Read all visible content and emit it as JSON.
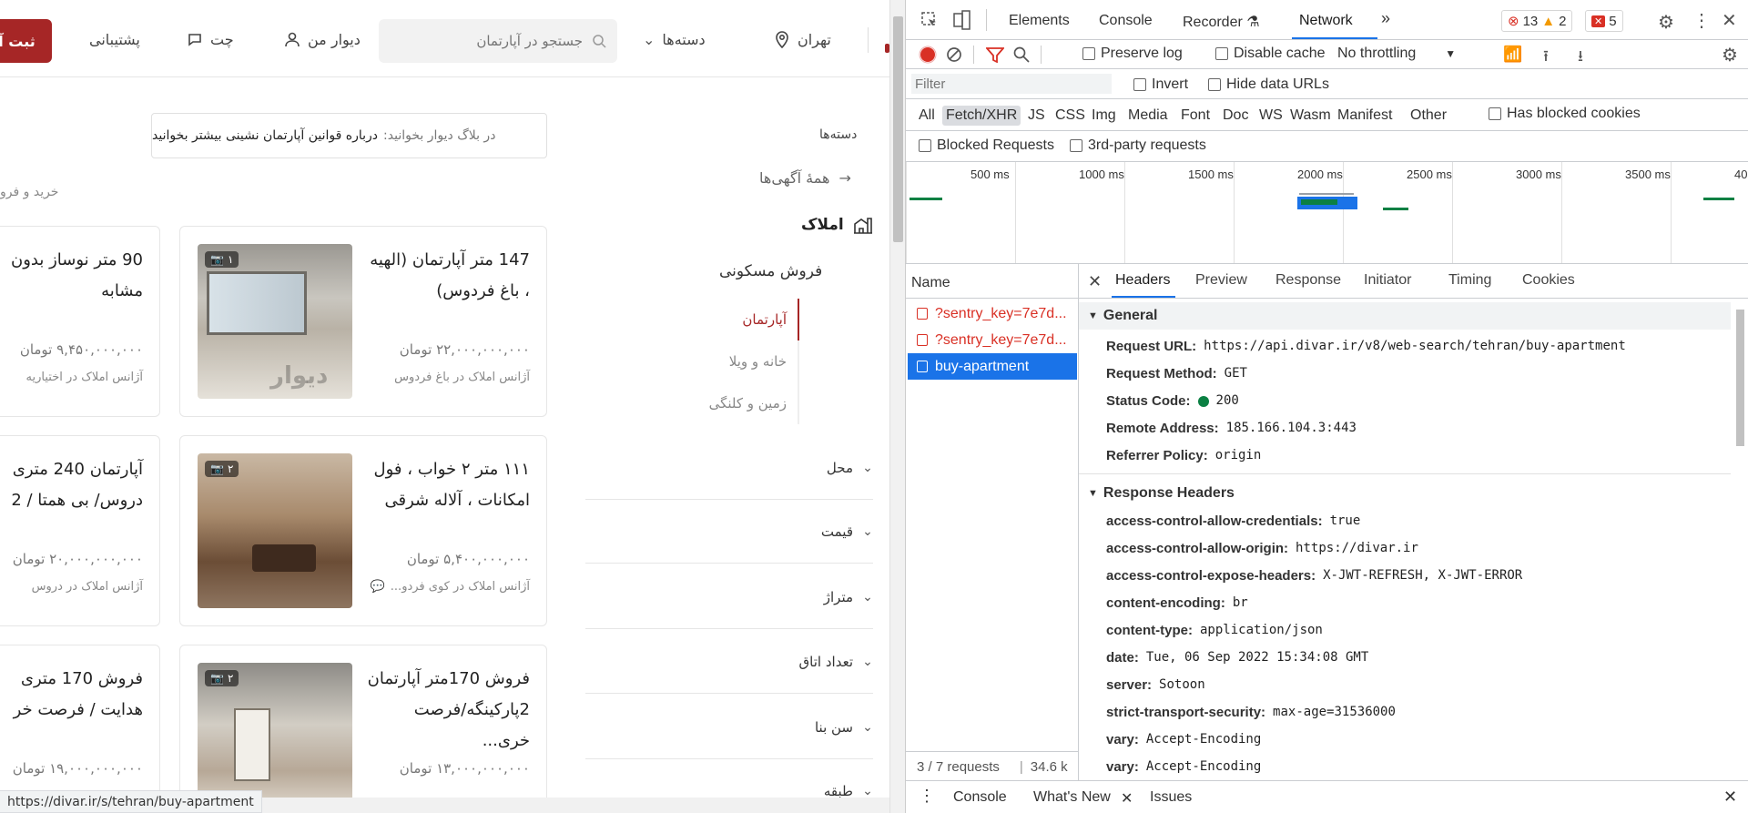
{
  "site": {
    "header": {
      "post_label": "ثبت آ",
      "support_label": "پشتیبانی",
      "chat_label": "چت",
      "mydivar_label": "دیوار من",
      "search_placeholder": "جستجو در آپارتمان",
      "categories_label": "دسته‌ها",
      "city_label": "تهران"
    },
    "blog": {
      "prefix": "در بلاگ دیوار بخوانید:",
      "link": "درباره قوانین آپارتمان نشینی بیشتر بخوانید"
    },
    "breadcrumb": "خرید و فرو",
    "sidebar": {
      "title": "دسته‌ها",
      "all_ads": "همهٔ آگهی‌ها",
      "category": "املاک",
      "subcategory": "فروش مسکونی",
      "items": [
        {
          "label": "آپارتمان",
          "active": true
        },
        {
          "label": "خانه و ویلا",
          "active": false
        },
        {
          "label": "زمین و کلنگی",
          "active": false
        }
      ],
      "filters": [
        "محل",
        "قیمت",
        "متراژ",
        "تعداد اتاق",
        "سن بنا",
        "طبقه"
      ]
    },
    "cards": [
      {
        "title": "147 متر آپارتمان (الهیه ، باغ فردوس)",
        "price": "۲۲,۰۰۰,۰۰۰,۰۰۰ تومان",
        "agency": "آژانس املاک در باغ فردوس",
        "photos": "۱",
        "chat": false
      },
      {
        "title": "90 متر نوساز بدون مشابه",
        "price": "۹,۴۵۰,۰۰۰,۰۰۰ تومان",
        "agency": "آژانس املاک در اختیاریه",
        "photos": "",
        "chat": false
      },
      {
        "title": "۱۱۱ متر ۲ خواب ، فول امکانات ، آلاله شرقی",
        "price": "۵,۴۰۰,۰۰۰,۰۰۰ تومان",
        "agency": "آژانس املاک در کوی فردو...",
        "photos": "۲",
        "chat": true
      },
      {
        "title": "آپارتمان 240 متری دروس/ بی همتا / 2",
        "price": "۲۰,۰۰۰,۰۰۰,۰۰۰ تومان",
        "agency": "آژانس املاک در دروس",
        "photos": "",
        "chat": false
      },
      {
        "title": "فروش 170متر آپارتمان 2پارکینگه/فرصت خری...",
        "price": "۱۳,۰۰۰,۰۰۰,۰۰۰ تومان",
        "agency": "",
        "photos": "۲",
        "chat": false
      },
      {
        "title": "فروش 170 متری هدایت / فرصت خر",
        "price": "۱۹,۰۰۰,۰۰۰,۰۰۰ تومان",
        "agency": "",
        "photos": "",
        "chat": false
      }
    ],
    "watermark": "دیوار",
    "status_url": "https://divar.ir/s/tehran/buy-apartment"
  },
  "devtools": {
    "tabs": [
      "Elements",
      "Console",
      "Recorder",
      "Network"
    ],
    "counts": {
      "errors": "13",
      "warnings": "2",
      "issues": "5"
    },
    "toolbar": {
      "preserve_log": "Preserve log",
      "disable_cache": "Disable cache",
      "throttling": "No throttling"
    },
    "filter_placeholder": "Filter",
    "invert": "Invert",
    "hide_data_urls": "Hide data URLs",
    "types": [
      "All",
      "Fetch/XHR",
      "JS",
      "CSS",
      "Img",
      "Media",
      "Font",
      "Doc",
      "WS",
      "Wasm",
      "Manifest",
      "Other"
    ],
    "has_blocked_cookies": "Has blocked cookies",
    "blocked_requests": "Blocked Requests",
    "third_party": "3rd-party requests",
    "timeline_labels": [
      "500 ms",
      "1000 ms",
      "1500 ms",
      "2000 ms",
      "2500 ms",
      "3000 ms",
      "3500 ms",
      "40"
    ],
    "name_header": "Name",
    "requests": [
      {
        "name": "?sentry_key=7e7d...",
        "state": "error"
      },
      {
        "name": "?sentry_key=7e7d...",
        "state": "error"
      },
      {
        "name": "buy-apartment",
        "state": "selected"
      }
    ],
    "footer": {
      "requests": "3 / 7 requests",
      "size": "34.6 k"
    },
    "detail_tabs": [
      "Headers",
      "Preview",
      "Response",
      "Initiator",
      "Timing",
      "Cookies"
    ],
    "general_title": "General",
    "general": [
      {
        "k": "Request URL:",
        "v": "https://api.divar.ir/v8/web-search/tehran/buy-apartment"
      },
      {
        "k": "Request Method:",
        "v": "GET"
      },
      {
        "k": "Status Code:",
        "v": "200"
      },
      {
        "k": "Remote Address:",
        "v": "185.166.104.3:443"
      },
      {
        "k": "Referrer Policy:",
        "v": "origin"
      }
    ],
    "response_title": "Response Headers",
    "response": [
      {
        "k": "access-control-allow-credentials:",
        "v": "true"
      },
      {
        "k": "access-control-allow-origin:",
        "v": "https://divar.ir"
      },
      {
        "k": "access-control-expose-headers:",
        "v": "X-JWT-REFRESH, X-JWT-ERROR"
      },
      {
        "k": "content-encoding:",
        "v": "br"
      },
      {
        "k": "content-type:",
        "v": "application/json"
      },
      {
        "k": "date:",
        "v": "Tue, 06 Sep 2022 15:34:08 GMT"
      },
      {
        "k": "server:",
        "v": "Sotoon"
      },
      {
        "k": "strict-transport-security:",
        "v": "max-age=31536000"
      },
      {
        "k": "vary:",
        "v": "Accept-Encoding"
      },
      {
        "k": "vary:",
        "v": "Accept-Encoding"
      }
    ],
    "drawer": [
      "Console",
      "What's New",
      "Issues"
    ],
    "colors": {
      "accent": "#1a73e8",
      "error": "#d93025",
      "divar_red": "#a62626",
      "status_ok": "#0b8043"
    }
  }
}
